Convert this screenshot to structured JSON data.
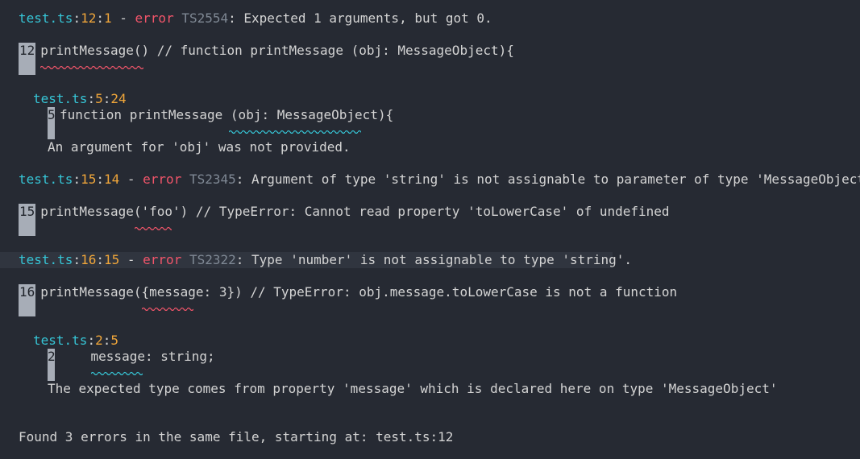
{
  "errors": [
    {
      "file": "test.ts",
      "line": "12",
      "col": "1",
      "sep1": ":",
      "sep2": ":",
      "dash": " - ",
      "kind": "error",
      "code": "TS2554",
      "message": ": Expected 1 arguments, but got 0.",
      "snippet_line": "12",
      "snippet": "printMessage() // function printMessage (obj: MessageObject){",
      "related": {
        "file": "test.ts",
        "line": "5",
        "col": "24",
        "snippet_line": "5",
        "snippet": "function printMessage (obj: MessageObject){",
        "note": "An argument for 'obj' was not provided."
      }
    },
    {
      "file": "test.ts",
      "line": "15",
      "col": "14",
      "kind": "error",
      "code": "TS2345",
      "message": ": Argument of type 'string' is not assignable to parameter of type 'MessageObject'.",
      "snippet_line": "15",
      "snippet": "printMessage('foo') // TypeError: Cannot read property 'toLowerCase' of undefined"
    },
    {
      "file": "test.ts",
      "line": "16",
      "col": "15",
      "kind": "error",
      "code": "TS2322",
      "message": ": Type 'number' is not assignable to type 'string'.",
      "snippet_line": "16",
      "snippet": "printMessage({message: 3}) // TypeError: obj.message.toLowerCase is not a function",
      "related": {
        "file": "test.ts",
        "line": "2",
        "col": "5",
        "snippet_line": "2",
        "snippet": "    message: string;",
        "note": "The expected type comes from property 'message' which is declared here on type 'MessageObject'"
      }
    }
  ],
  "summary": "Found 3 errors in the same file, starting at: test.ts:12",
  "colors": {
    "background": "#262a33",
    "file": "#36c5d6",
    "number": "#f0a63a",
    "error": "#f2556a",
    "text": "#d4d4d4"
  }
}
